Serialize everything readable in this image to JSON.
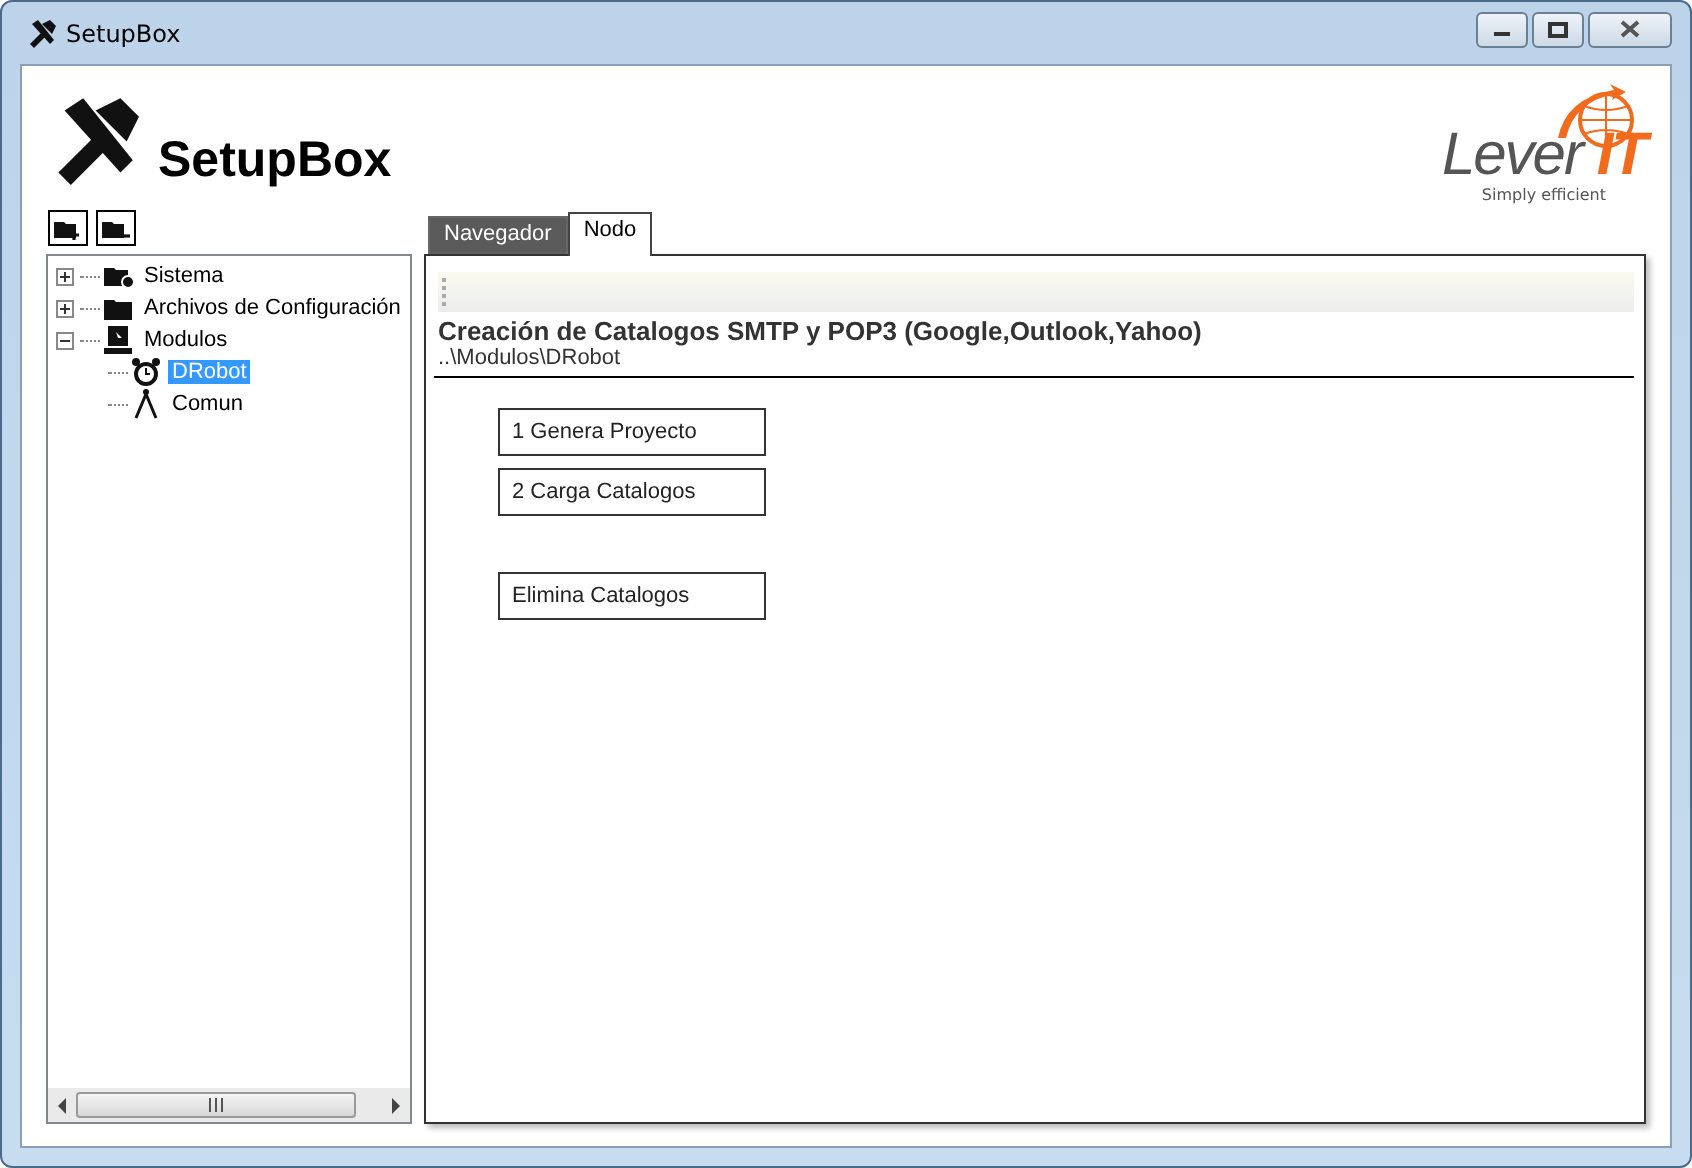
{
  "window": {
    "title": "SetupBox"
  },
  "header": {
    "title": "SetupBox",
    "logo": {
      "word": "Lever",
      "accent": "IT",
      "tagline": "Simply efficient"
    }
  },
  "tree": {
    "items": [
      {
        "label": "Sistema",
        "expanded": false,
        "selected": false
      },
      {
        "label": "Archivos de Configuración",
        "expanded": false,
        "selected": false
      },
      {
        "label": "Modulos",
        "expanded": true,
        "selected": false,
        "children": [
          {
            "label": "DRobot",
            "selected": true
          },
          {
            "label": "Comun",
            "selected": false
          }
        ]
      }
    ]
  },
  "tabs": [
    {
      "label": "Navegador",
      "selected": false
    },
    {
      "label": "Nodo",
      "selected": true
    }
  ],
  "node": {
    "heading": "Creación de Catalogos SMTP y POP3 (Google,Outlook,Yahoo)",
    "path": "..\\Modulos\\DRobot",
    "actions": [
      {
        "label": "1 Genera Proyecto"
      },
      {
        "label": "2 Carga Catalogos"
      },
      {
        "label": "Elimina Catalogos"
      }
    ]
  }
}
